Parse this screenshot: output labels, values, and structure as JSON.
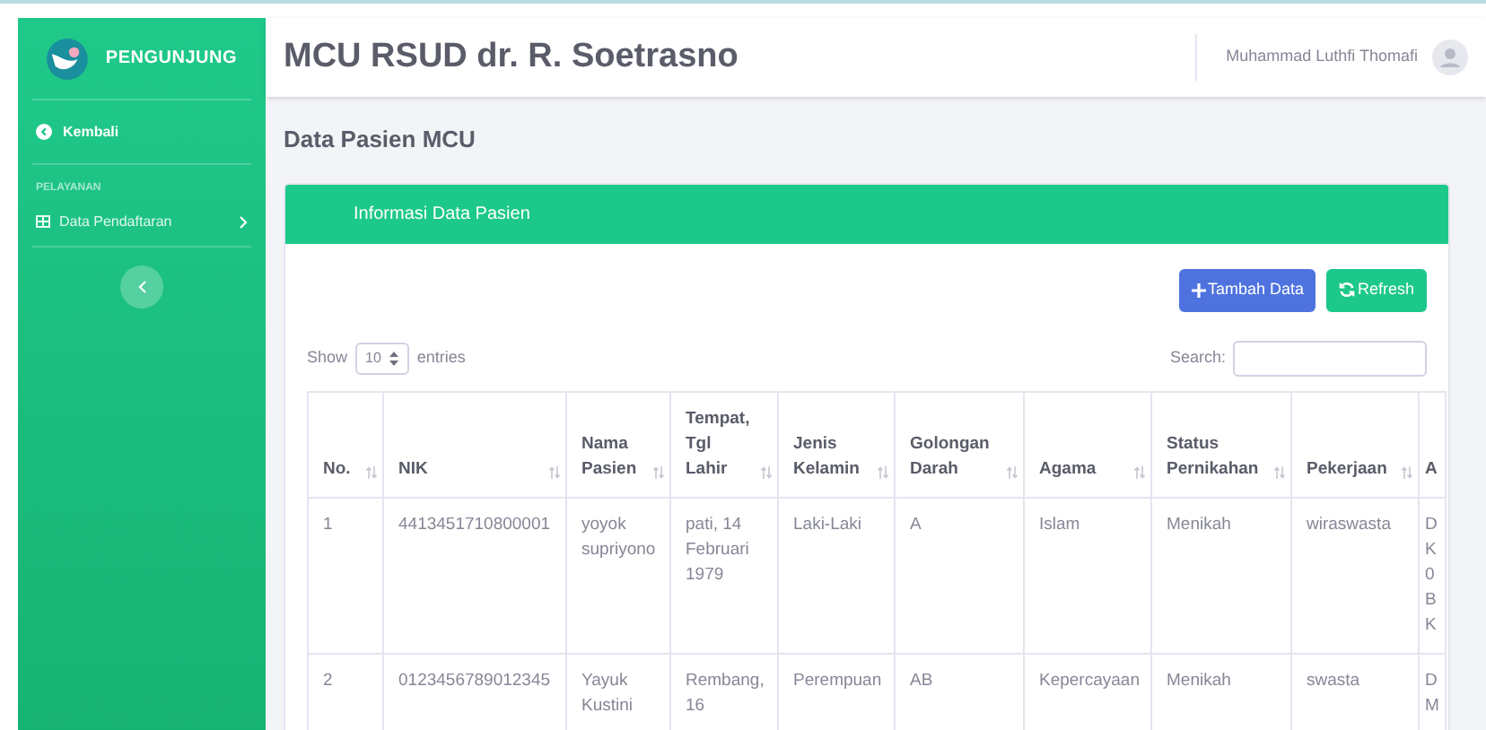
{
  "sidebar": {
    "brand": "PENGUNJUNG",
    "items": [
      {
        "kind": "back",
        "label": "Kembali"
      },
      {
        "kind": "heading",
        "label": "PELAYANAN"
      },
      {
        "kind": "menu",
        "label": "Data Pendaftaran",
        "expanded": false
      }
    ]
  },
  "topbar": {
    "title": "MCU RSUD dr. R. Soetrasno",
    "user": "Muhammad Luthfi Thomafi"
  },
  "page_title": "Data Pasien MCU",
  "card": {
    "title": "Informasi Data Pasien",
    "buttons": [
      {
        "kind": "add",
        "label": "Tambah Data"
      },
      {
        "kind": "refresh",
        "label": "Refresh"
      }
    ],
    "length": {
      "before": "Show",
      "value": "10",
      "after": "entries"
    },
    "search": {
      "label": "Search:"
    },
    "table": {
      "columns": [
        {
          "label": "No."
        },
        {
          "label": "NIK"
        },
        {
          "label": "Nama Pasien"
        },
        {
          "label": "Tempat, Tgl Lahir"
        },
        {
          "label": "Jenis Kelamin"
        },
        {
          "label": "Golongan Darah"
        },
        {
          "label": "Agama"
        },
        {
          "label": "Status Pernikahan"
        },
        {
          "label": "Pekerjaan"
        },
        {
          "label": "A"
        }
      ],
      "rows": [
        [
          "1",
          "4413451710800001",
          "yoyok supriyono",
          "pati, 14 Februari 1979",
          "Laki-Laki",
          "A",
          "Islam",
          "Menikah",
          "wiraswasta",
          "D K 0 B K"
        ],
        [
          "2",
          "0123456789012345",
          "Yayuk Kustini",
          "Rembang, 16",
          "Perempuan",
          "AB",
          "Kepercayaan",
          "Menikah",
          "swasta",
          "D M"
        ]
      ]
    }
  }
}
